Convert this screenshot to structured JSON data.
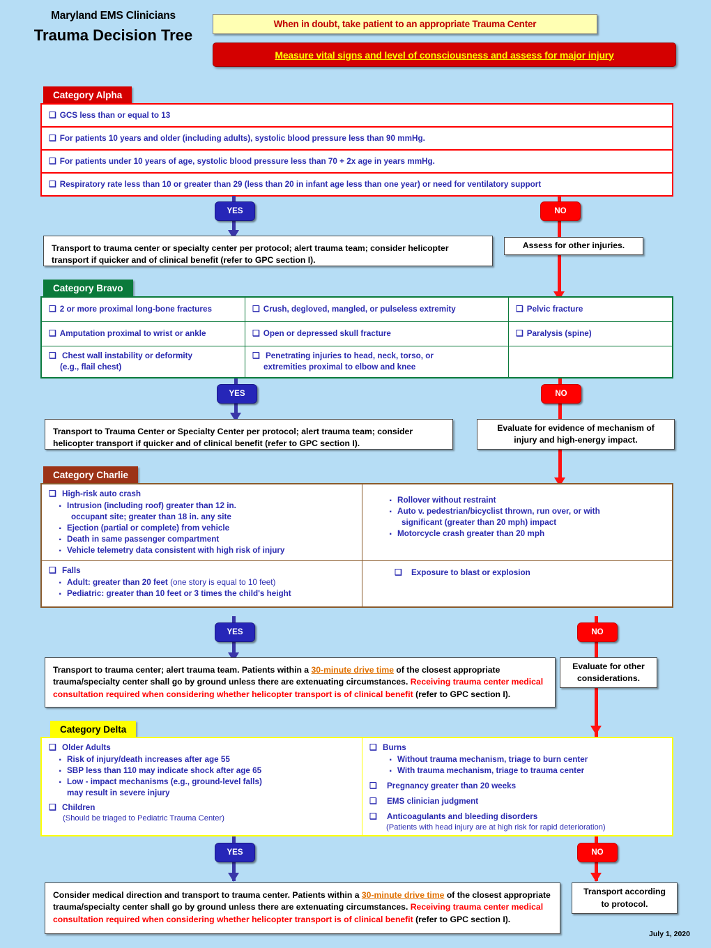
{
  "header": {
    "org": "Maryland EMS Clinicians",
    "title": "Trauma Decision Tree",
    "banner_yellow": "When in doubt, take patient to an appropriate Trauma Center",
    "banner_red": "Measure vital signs and level of consciousness and assess for major injury"
  },
  "labels": {
    "yes": "YES",
    "no": "NO"
  },
  "colors": {
    "background": "#b6ddf5",
    "alpha": "#d40000",
    "bravo": "#0b7a3b",
    "charlie": "#9c3317",
    "delta": "#ffff00",
    "yes_pill": "#2626b8",
    "no_pill": "#ff0000",
    "criteria_text": "#2b2bb0",
    "alert_text": "#ff0000",
    "drive_time_link": "#e07000"
  },
  "alpha": {
    "tab": "Category Alpha",
    "criteria": [
      "GCS less than or equal to 13",
      "For patients 10 years and older (including adults), systolic blood pressure less than 90 mmHg.",
      "For patients under 10 years of age, systolic blood pressure less than 70 + 2x age in years mmHg.",
      "Respiratory rate less than 10 or greater than 29 (less than 20 in infant age less than one year) or need for ventilatory support"
    ],
    "yes_outcome": "Transport to trauma center or specialty center per protocol; alert trauma team; consider helicopter transport if quicker and of clinical benefit (refer to GPC section I).",
    "no_outcome": "Assess for other injuries."
  },
  "bravo": {
    "tab": "Category Bravo",
    "criteria": [
      "2 or more proximal long-bone fractures",
      "Crush, degloved, mangled, or pulseless extremity",
      "Pelvic fracture",
      "Amputation proximal to wrist or ankle",
      "Open or depressed skull fracture",
      "Paralysis (spine)",
      "Chest wall instability or deformity",
      "Penetrating injuries to head, neck, torso, or"
    ],
    "chest_sub": "(e.g., flail chest)",
    "penetrating_sub": "extremities proximal to elbow and knee",
    "yes_outcome": "Transport to Trauma Center or Specialty Center per protocol; alert trauma team; consider helicopter transport if quicker and of clinical benefit (refer to GPC section I).",
    "no_outcome": "Evaluate for evidence of mechanism of injury and high-energy impact."
  },
  "charlie": {
    "tab": "Category Charlie",
    "auto_crash_heading": "High-risk auto crash",
    "auto_crash_items": [
      "Intrusion (including roof) greater than 12 in.",
      "occupant site; greater than 18 in. any site",
      "Ejection (partial or complete) from vehicle",
      "Death in same passenger compartment",
      "Vehicle telemetry data consistent with high risk of injury"
    ],
    "right_items": [
      "Rollover without restraint",
      "Auto v. pedestrian/bicyclist thrown, run over, or with",
      "significant (greater than 20 mph) impact",
      "Motorcycle crash greater than 20 mph"
    ],
    "falls_heading": "Falls",
    "falls_adult_bold": "Adult: greater than 20 feet",
    "falls_adult_note": "(one story is equal to 10 feet)",
    "falls_pediatric": "Pediatric: greater than 10 feet or 3 times the child's height",
    "blast": "Exposure to blast or explosion",
    "yes_outcome_p1": "Transport to trauma center; alert trauma team. Patients within a ",
    "yes_outcome_link": "30-minute drive time",
    "yes_outcome_p2": " of the closest appropriate trauma/specialty center shall go by ground unless there are extenuating circumstances. ",
    "yes_outcome_red": "Receiving trauma center medical consultation required when considering  whether helicopter transport is of clinical benefit ",
    "yes_outcome_p3": "(refer to GPC section I).",
    "no_outcome": "Evaluate for other considerations."
  },
  "delta": {
    "tab": "Category Delta",
    "older_adults_heading": "Older Adults",
    "older_adults_items": [
      "Risk of injury/death increases after age 55",
      "SBP less than 110 may indicate shock after age 65",
      "Low - impact mechanisms (e.g., ground-level falls)",
      "may result in severe injury"
    ],
    "children_heading": "Children",
    "children_note": "(Should be triaged to Pediatric Trauma Center)",
    "burns_heading": "Burns",
    "burns_items": [
      "Without trauma mechanism, triage to burn center",
      "With trauma mechanism, triage to trauma center"
    ],
    "other_items": [
      "Pregnancy greater than 20 weeks",
      "EMS clinician judgment",
      "Anticoagulants and bleeding disorders"
    ],
    "anticoag_note": "(Patients with head injury are at high risk for rapid deterioration)",
    "yes_outcome_p1": "Consider medical direction and transport to trauma center. Patients within a ",
    "yes_outcome_link": "30-minute drive time",
    "yes_outcome_p2": " of the closest appropriate trauma/specialty center shall go by ground unless there are extenuating circumstances. ",
    "yes_outcome_red": "Receiving trauma center medical consultation required when considering whether helicopter transport is of clinical benefit ",
    "yes_outcome_p3": "(refer to GPC section I).",
    "no_outcome": "Transport according to protocol."
  },
  "footer": {
    "date": "July 1, 2020"
  }
}
